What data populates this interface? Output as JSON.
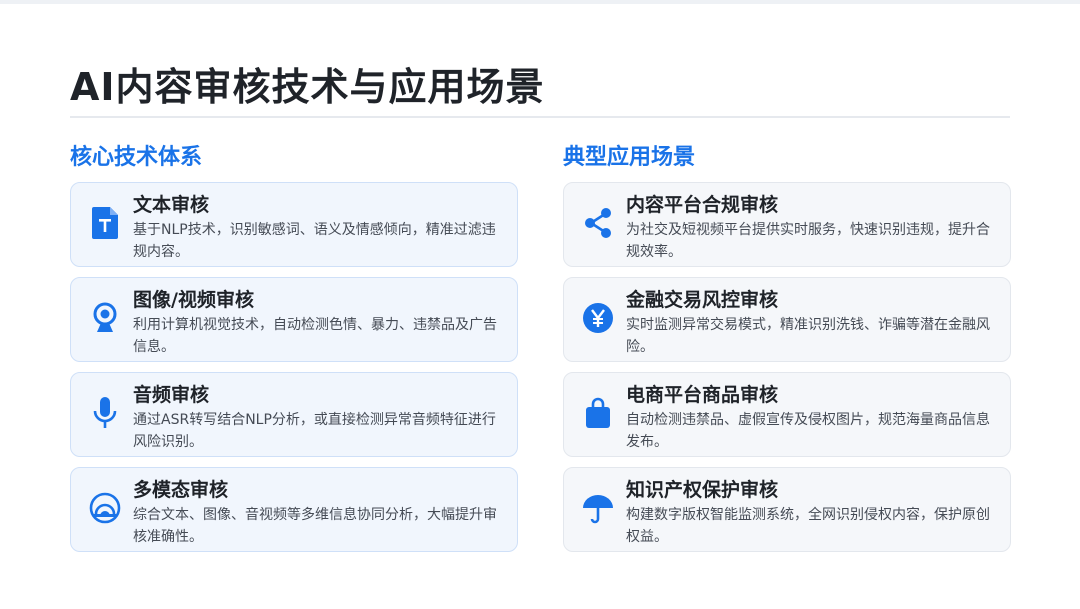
{
  "title": "AI内容审核技术与应用场景",
  "left": {
    "heading": "核心技术体系",
    "cards": [
      {
        "icon": "document-text-icon",
        "title": "文本审核",
        "desc": "基于NLP技术，识别敏感词、语义及情感倾向，精准过滤违规内容。"
      },
      {
        "icon": "webcam-icon",
        "title": "图像/视频审核",
        "desc": "利用计算机视觉技术，自动检测色情、暴力、违禁品及广告信息。"
      },
      {
        "icon": "microphone-icon",
        "title": "音频审核",
        "desc": "通过ASR转写结合NLP分析，或直接检测异常音频特征进行风险识别。"
      },
      {
        "icon": "multimodal-signal-icon",
        "title": "多模态审核",
        "desc": "综合文本、图像、音视频等多维信息协同分析，大幅提升审核准确性。"
      }
    ]
  },
  "right": {
    "heading": "典型应用场景",
    "cards": [
      {
        "icon": "share-icon",
        "title": "内容平台合规审核",
        "desc": "为社交及短视频平台提供实时服务，快速识别违规，提升合规效率。"
      },
      {
        "icon": "yen-coin-icon",
        "title": "金融交易风控审核",
        "desc": "实时监测异常交易模式，精准识别洗钱、诈骗等潜在金融风险。"
      },
      {
        "icon": "shopping-bag-icon",
        "title": "电商平台商品审核",
        "desc": "自动检测违禁品、虚假宣传及侵权图片，规范海量商品信息发布。"
      },
      {
        "icon": "umbrella-icon",
        "title": "知识产权保护审核",
        "desc": "构建数字版权智能监测系统，全网识别侵权内容，保护原创权益。"
      }
    ]
  },
  "colors": {
    "accent": "#1a73e8",
    "title": "#1f2329",
    "text": "#454b55"
  }
}
